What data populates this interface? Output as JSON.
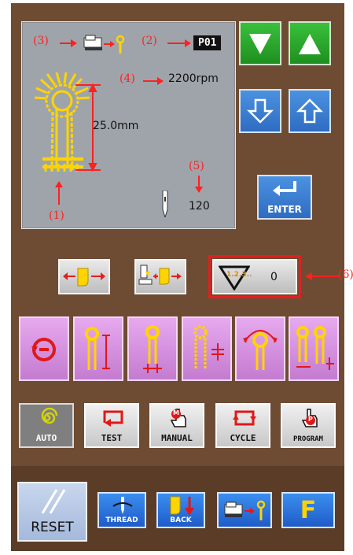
{
  "display": {
    "program_label": "P01",
    "speed": "2200rpm",
    "length": "25.0mm",
    "needle_count": "120",
    "callouts": {
      "c1": "(1)",
      "c2": "(2)",
      "c3": "(3)",
      "c4": "(4)",
      "c5": "(5)",
      "c6": "(6)"
    }
  },
  "right_buttons": {
    "enter_label": "ENTER"
  },
  "counter": {
    "icon_text": "1.2.3..",
    "value": "0"
  },
  "modes": {
    "auto": "AUTO",
    "test": "TEST",
    "manual": "MANUAL",
    "cycle": "CYCLE",
    "program": "PROGRAM",
    "manual_icon_letter": "M",
    "program_icon_letter": "P"
  },
  "bottom": {
    "reset": "RESET",
    "thread": "THREAD",
    "back": "BACK",
    "f_label": "F"
  },
  "colors": {
    "panel": "#6e4c33",
    "accent_green": "#2fa82f",
    "accent_blue": "#2f6cc2",
    "accent_purple": "#d38bde",
    "callout_red": "#ff2020",
    "buttonhole_yellow": "#ffd400"
  }
}
